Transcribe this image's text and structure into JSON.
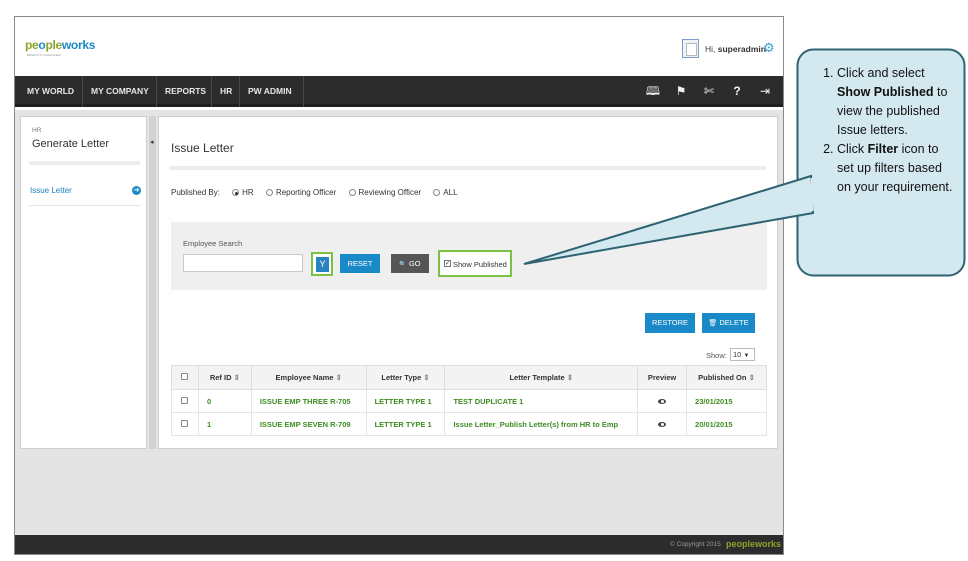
{
  "header": {
    "logo_text_a": "pe",
    "logo_text_b": "o",
    "logo_text_c": "ple",
    "logo_text_d": "works",
    "logo_tagline": "BENEFITS UNLEASHED",
    "greeting_prefix": "Hi,",
    "username": "superadmin",
    "icons": [
      "user-avatar-icon",
      "gear-icon"
    ]
  },
  "nav": {
    "items": [
      "MY WORLD",
      "MY COMPANY",
      "REPORTS",
      "HR",
      "PW ADMIN"
    ],
    "icons": [
      "book-icon",
      "flag-icon",
      "tools-icon",
      "help-icon",
      "logout-icon"
    ],
    "icon_glyphs": [
      "🕮",
      "⚑",
      "✄",
      "?",
      "⇥"
    ]
  },
  "sidebar": {
    "section": "HR",
    "title": "Generate Letter",
    "item_label": "Issue Letter",
    "item_arrow": "➜",
    "collapse_glyph": "◂"
  },
  "main": {
    "title": "Issue Letter",
    "published_by_label": "Published By:",
    "radio_options": [
      "HR",
      "Reporting Officer",
      "Reviewing Officer",
      "ALL"
    ],
    "radio_selected": "HR",
    "search": {
      "label": "Employee Search",
      "value": "",
      "placeholder": "",
      "filter_glyph": "Y",
      "reset_label": "RESET",
      "go_label": "GO",
      "go_glyph": "🔍",
      "show_published_label": "Show Published",
      "show_published_checked": true
    },
    "restore_label": "RESTORE",
    "delete_label": "DELETE",
    "delete_glyph": "🗑",
    "show_label": "Show:",
    "show_value": "10",
    "table": {
      "columns": [
        "Ref ID",
        "Employee Name",
        "Letter Type",
        "Letter Template",
        "Preview",
        "Published On"
      ],
      "sort_glyph": "⇕",
      "rows": [
        {
          "ref_id": "0",
          "employee": "ISSUE EMP THREE R-705",
          "letter_type": "LETTER TYPE 1",
          "template": "TEST DUPLICATE 1",
          "published_on": "23/01/2015"
        },
        {
          "ref_id": "1",
          "employee": "ISSUE EMP SEVEN R-709",
          "letter_type": "LETTER TYPE 1",
          "template": "Issue Letter_Publish Letter(s) from HR to Emp",
          "published_on": "20/01/2015"
        }
      ]
    }
  },
  "footer": {
    "copyright": "© Copyright 2015",
    "logo": "peopleworks"
  },
  "callout": {
    "step1_prefix": "Click and select",
    "step1_bold": "Show Published",
    "step1_suffix": "to view the published Issue letters.",
    "step2_prefix": "Click",
    "step2_bold": "Filter",
    "step2_suffix": "icon to set up filters based on your requirement.",
    "fill_color": "#d4e8f0",
    "border_color": "#2e6372"
  },
  "colors": {
    "accent_blue": "#1a89c8",
    "highlight_green": "#7cc142",
    "row_green": "#3d8c21",
    "nav_dark": "#2c2c2c"
  }
}
